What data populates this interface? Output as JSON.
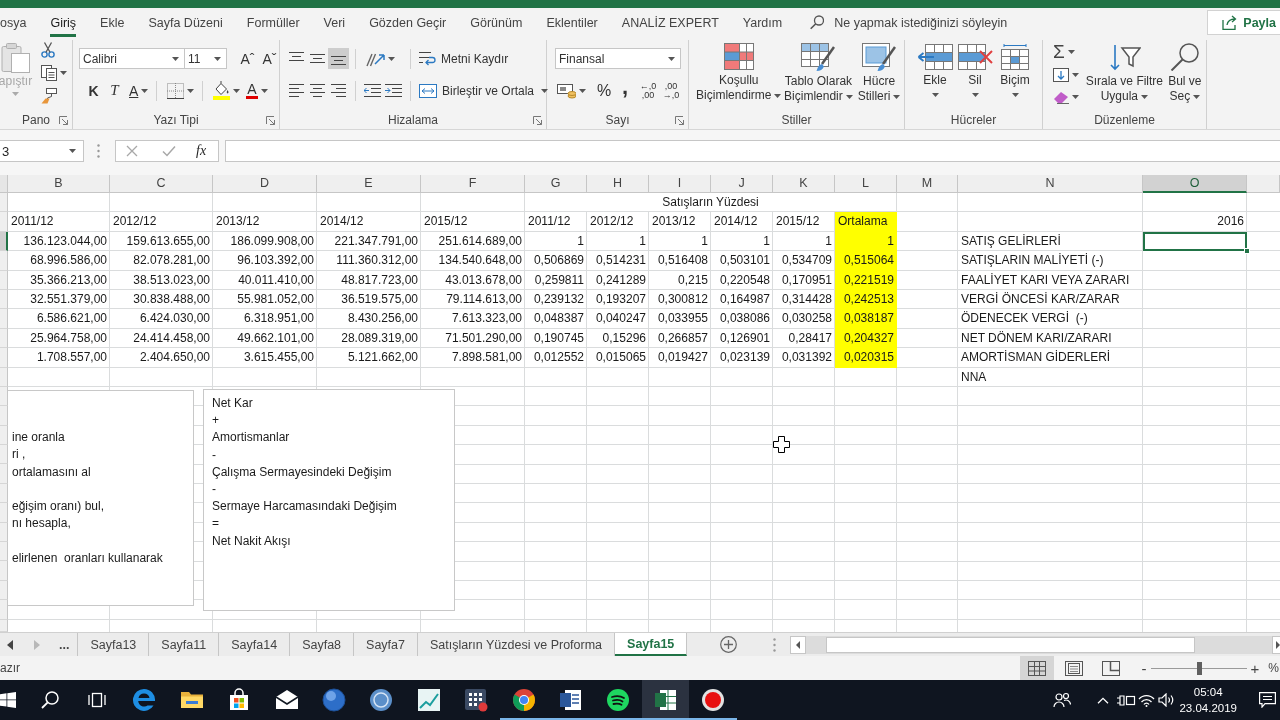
{
  "menu": {
    "tabs": [
      {
        "label": "osya",
        "selected": false
      },
      {
        "label": "Giriş",
        "selected": true
      },
      {
        "label": "Ekle",
        "selected": false
      },
      {
        "label": "Sayfa Düzeni",
        "selected": false
      },
      {
        "label": "Formüller",
        "selected": false
      },
      {
        "label": "Veri",
        "selected": false
      },
      {
        "label": "Gözden Geçir",
        "selected": false
      },
      {
        "label": "Görünüm",
        "selected": false
      },
      {
        "label": "Eklentiler",
        "selected": false
      },
      {
        "label": "ANALİZ EXPERT",
        "selected": false
      },
      {
        "label": "Yardım",
        "selected": false
      }
    ],
    "search": {
      "placeholder": "Ne yapmak istediğinizi söyleyin"
    },
    "share": "Payla"
  },
  "ribbon": {
    "clipboard": {
      "title": "Pano",
      "paste": {
        "label": "apıştır",
        "disabled": true
      }
    },
    "font": {
      "title": "Yazı Tipi",
      "font_name": "Calibri",
      "font_size": "11",
      "grow": "Aˆ",
      "shrink": "Aˇ",
      "bold": "K",
      "italic": "T",
      "underline": "A",
      "font_color": "A"
    },
    "alignment": {
      "title": "Hizalama",
      "vertical": [
        {
          "selected": false
        },
        {
          "selected": false
        },
        {
          "selected": true
        }
      ],
      "horizontal": [
        {
          "selected": false
        },
        {
          "selected": false
        },
        {
          "selected": false
        }
      ],
      "wrap": "Metni Kaydır",
      "merge": "Birleştir ve Ortala"
    },
    "number": {
      "title": "Sayı",
      "format": "Finansal",
      "percent": "%",
      "comma": ",",
      "decimals": [
        "←,0\n,00",
        ",00\n→,0"
      ]
    },
    "styles": {
      "title": "Stiller",
      "buttons": [
        [
          "Koşullu",
          "Biçimlendirme"
        ],
        [
          "Tablo Olarak",
          "Biçimlendir"
        ],
        [
          "Hücre",
          "Stilleri"
        ]
      ]
    },
    "cells": {
      "title": "Hücreler",
      "buttons": [
        "Ekle",
        "Sil",
        "Biçim"
      ]
    },
    "editing": {
      "title": "Düzenleme",
      "autosum": "Σ",
      "sort": [
        "Sırala ve Filtre",
        "Uygula"
      ],
      "find": [
        "Bul ve",
        "Seç"
      ]
    }
  },
  "formula_bar": {
    "name_box": "3",
    "fx": "fx"
  },
  "sheet": {
    "columns": [
      {
        "label": "B",
        "selected": false
      },
      {
        "label": "C",
        "selected": false
      },
      {
        "label": "D",
        "selected": false
      },
      {
        "label": "E",
        "selected": false
      },
      {
        "label": "F",
        "selected": false
      },
      {
        "label": "G",
        "selected": false
      },
      {
        "label": "H",
        "selected": false
      },
      {
        "label": "I",
        "selected": false
      },
      {
        "label": "J",
        "selected": false
      },
      {
        "label": "K",
        "selected": false
      },
      {
        "label": "L",
        "selected": false
      },
      {
        "label": "M",
        "selected": false
      },
      {
        "label": "N",
        "selected": false
      },
      {
        "label": "O",
        "selected": true
      }
    ],
    "banner": "Satışların Yüzdesi",
    "rows": [
      {
        "selected": false,
        "cells": [
          "2011/12",
          "2012/12",
          "2013/12",
          "2014/12",
          "2015/12",
          "2011/12",
          "2012/12",
          "2013/12",
          "2014/12",
          "2015/12",
          {
            "text": "Ortalama",
            "color": "#ffff00"
          },
          null,
          null,
          "2016"
        ]
      },
      {
        "selected": true,
        "cells": [
          "136.123.044,00",
          "159.613.655,00",
          "186.099.908,00",
          "221.347.791,00",
          "251.614.689,00",
          "1",
          "1",
          "1",
          "1",
          "1",
          {
            "text": "1",
            "color": "#ffff00"
          },
          null,
          "SATIŞ GELİRLERİ",
          null
        ]
      },
      {
        "selected": false,
        "cells": [
          "68.996.586,00",
          "82.078.281,00",
          "96.103.392,00",
          "111.360.312,00",
          "134.540.648,00",
          "0,506869",
          "0,514231",
          "0,516408",
          "0,503101",
          "0,534709",
          {
            "text": "0,515064",
            "color": "#ffff00"
          },
          null,
          "SATIŞLARIN MALİYETİ (-)",
          null
        ]
      },
      {
        "selected": false,
        "cells": [
          "35.366.213,00",
          "38.513.023,00",
          "40.011.410,00",
          "48.817.723,00",
          "43.013.678,00",
          "0,259811",
          "0,241289",
          "0,215",
          "0,220548",
          "0,170951",
          {
            "text": "0,221519",
            "color": "#ffff00"
          },
          null,
          "FAALİYET KARI VEYA ZARARI",
          null
        ]
      },
      {
        "selected": false,
        "cells": [
          "32.551.379,00",
          "30.838.488,00",
          "55.981.052,00",
          "36.519.575,00",
          "79.114.613,00",
          "0,239132",
          "0,193207",
          "0,300812",
          "0,164987",
          "0,314428",
          {
            "text": "0,242513",
            "color": "#ffff00"
          },
          null,
          "VERGİ ÖNCESİ KAR/ZARAR",
          null
        ]
      },
      {
        "selected": false,
        "cells": [
          "6.586.621,00",
          "6.424.030,00",
          "6.318.951,00",
          "8.430.256,00",
          "7.613.323,00",
          "0,048387",
          "0,040247",
          "0,033955",
          "0,038086",
          "0,030258",
          {
            "text": "0,038187",
            "color": "#ffff00"
          },
          null,
          "ÖDENECEK VERGİ  (-)",
          null
        ]
      },
      {
        "selected": false,
        "cells": [
          "25.964.758,00",
          "24.414.458,00",
          "49.662.101,00",
          "28.089.319,00",
          "71.501.290,00",
          "0,190745",
          "0,15296",
          "0,266857",
          "0,126901",
          "0,28417",
          {
            "text": "0,204327",
            "color": "#ffff00"
          },
          null,
          "NET DÖNEM KARI/ZARARI",
          null
        ]
      },
      {
        "selected": false,
        "cells": [
          "1.708.557,00",
          "2.404.650,00",
          "3.615.455,00",
          "5.121.662,00",
          "7.898.581,00",
          "0,012552",
          "0,015065",
          "0,019427",
          "0,023139",
          "0,031392",
          {
            "text": "0,020315",
            "color": "#ffff00"
          },
          null,
          "AMORTİSMAN GİDERLERİ",
          null
        ]
      },
      {
        "selected": false,
        "cells": [
          null,
          null,
          null,
          null,
          null,
          null,
          null,
          null,
          null,
          null,
          null,
          null,
          "NNA",
          null
        ]
      }
    ]
  },
  "text_boxes": [
    {
      "paragraphs": [
        [
          "ine oranla",
          "ri ,",
          "ortalamasını al"
        ],
        [
          "eğişim oranı) bul,",
          "nı hesapla,"
        ],
        [
          "elirlenen  oranları kullanarak"
        ]
      ]
    },
    {
      "paragraphs": [
        [
          "Net Kar",
          "+",
          "Amortismanlar",
          "-",
          "Çalışma Sermayesindeki Değişim",
          "-",
          "Sermaye Harcamasındaki Değişim",
          "=",
          "Net Nakit Akışı"
        ]
      ]
    }
  ],
  "sheet_tabs": {
    "nav": [
      {
        "disabled": false
      },
      {
        "disabled": true
      }
    ],
    "more": "...",
    "tabs": [
      {
        "label": "Sayfa13",
        "selected": false
      },
      {
        "label": "Sayfa11",
        "selected": false
      },
      {
        "label": "Sayfa14",
        "selected": false
      },
      {
        "label": "Sayfa8",
        "selected": false
      },
      {
        "label": "Sayfa7",
        "selected": false
      },
      {
        "label": "Satışların Yüzdesi ve Proforma",
        "selected": false
      },
      {
        "label": "Sayfa15",
        "selected": true
      }
    ]
  },
  "status_bar": {
    "status": "azır",
    "views": [
      {
        "kind": "normal",
        "selected": true
      },
      {
        "kind": "page_layout",
        "selected": false
      },
      {
        "kind": "page_break",
        "selected": false
      }
    ],
    "zoom": {
      "minus": "-",
      "plus": "+",
      "level": 0.5,
      "percent": "%"
    }
  },
  "taskbar": {
    "apps": [
      {
        "running": false,
        "active": false
      },
      {
        "running": false,
        "active": false
      },
      {
        "running": false,
        "active": false
      },
      {
        "running": false,
        "active": false
      },
      {
        "running": false,
        "active": false
      },
      {
        "running": false,
        "active": false
      },
      {
        "running": false,
        "active": false
      },
      {
        "running": false,
        "active": false
      },
      {
        "running": true,
        "active": false
      },
      {
        "running": true,
        "active": false
      },
      {
        "running": true,
        "active": false
      },
      {
        "running": true,
        "active": true
      },
      {
        "running": true,
        "active": false
      }
    ],
    "time": "05:04",
    "date": "23.04.2019"
  }
}
